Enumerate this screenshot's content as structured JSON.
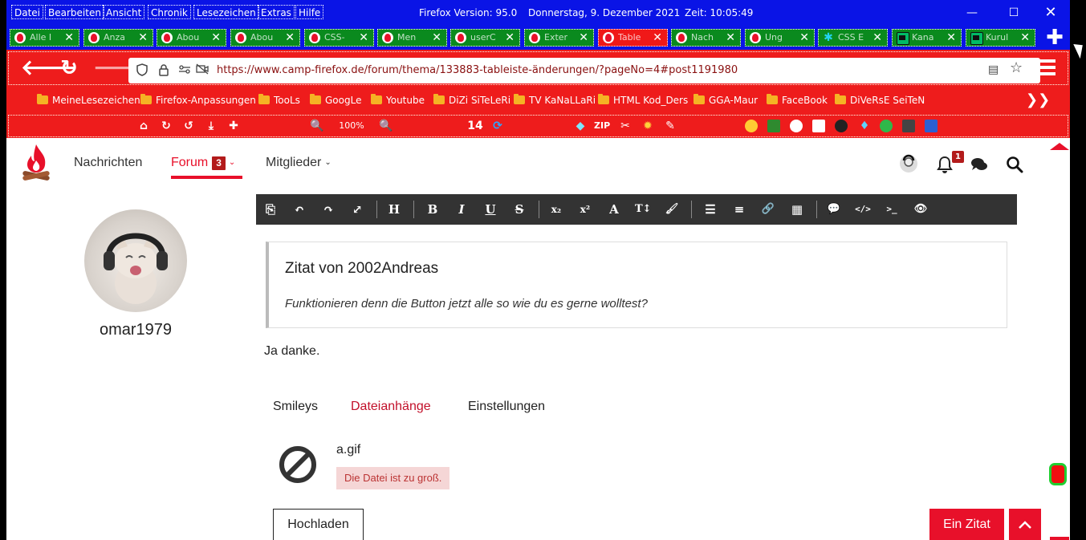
{
  "menubar": {
    "items": [
      {
        "label": "Datei"
      },
      {
        "label": "Bearbeiten"
      },
      {
        "label": "Ansicht"
      },
      {
        "label": "Chronik"
      },
      {
        "label": "Lesezeichen"
      },
      {
        "label": "Extras"
      },
      {
        "label": "Hilfe"
      }
    ],
    "version": "Firefox Version: 95.0",
    "date": "Donnerstag, 9. Dezember 2021",
    "time": "Zeit:  10:05:49",
    "minimize": "—",
    "maximize": "☐",
    "close": "✕"
  },
  "tabs": [
    {
      "label": "Alle I",
      "icon": "flame"
    },
    {
      "label": "Anza",
      "icon": "flame"
    },
    {
      "label": "Abou",
      "icon": "flame"
    },
    {
      "label": "Abou",
      "icon": "flame"
    },
    {
      "label": "CSS-",
      "icon": "flame"
    },
    {
      "label": "Men",
      "icon": "flame"
    },
    {
      "label": "userC",
      "icon": "flame"
    },
    {
      "label": "Exter",
      "icon": "flame"
    },
    {
      "label": "Table",
      "icon": "flame",
      "active": true
    },
    {
      "label": "Nach",
      "icon": "flame"
    },
    {
      "label": "Ung",
      "icon": "flame"
    },
    {
      "label": "CSS E",
      "icon": "css"
    },
    {
      "label": "Kana",
      "icon": "tv"
    },
    {
      "label": "Kurul",
      "icon": "tv"
    }
  ],
  "tab_close": "✕",
  "newtab_label": "✚",
  "navbar": {
    "back": "🡐",
    "reload": "↻",
    "forward": "🡒",
    "url": "https://www.camp-firefox.de/forum/thema/133883-tableiste-änderungen/?pageNo=4#post1191980",
    "star": "☆",
    "reader": "▤"
  },
  "bookmarks": [
    "MeineLesezeichen",
    "Firefox-Anpassungen",
    "TooLs",
    "GoogLe",
    "Youtube",
    "DiZi SiTeLeRi",
    "TV KaNaLLaRi",
    "HTML Kod_Ders",
    "GGA-Maur",
    "FaceBook",
    "DiVeRsE SeiTeN"
  ],
  "bookmarks_more": "❯❯",
  "toolbar": {
    "zoom": "100%",
    "counter": "14"
  },
  "site": {
    "nav": {
      "news": "Nachrichten",
      "forum": "Forum",
      "forum_badge": "3",
      "members": "Mitglieder"
    },
    "notif_badge": "1",
    "username": "omar1979"
  },
  "editor": {
    "buttons": [
      "⎘",
      "↶",
      "↷",
      "⤢",
      "H",
      "B",
      "I",
      "U",
      "S",
      "x₂",
      "x²",
      "A",
      "T↕",
      "🖌",
      "☰",
      "≡",
      "🔗",
      "▦",
      "💬",
      "</>",
      ">_",
      "👁"
    ]
  },
  "post": {
    "quote_title": "Zitat von 2002Andreas",
    "quote_text": "Funktionieren denn die Button jetzt alle so wie du es gerne wolltest?",
    "body": "Ja danke."
  },
  "subtabs": {
    "smileys": "Smileys",
    "attachments": "Dateianhänge",
    "settings": "Einstellungen"
  },
  "attachment": {
    "filename": "a.gif",
    "error": "Die Datei ist zu groß."
  },
  "buttons": {
    "upload": "Hochladen",
    "quote": "Ein Zitat",
    "to_top": "⌃"
  },
  "colors": {
    "chrome_blue": "#0a14e6",
    "chrome_red": "#ee1c1c",
    "tab_green": "#0a8a1e",
    "brand_red": "#e8102a"
  }
}
